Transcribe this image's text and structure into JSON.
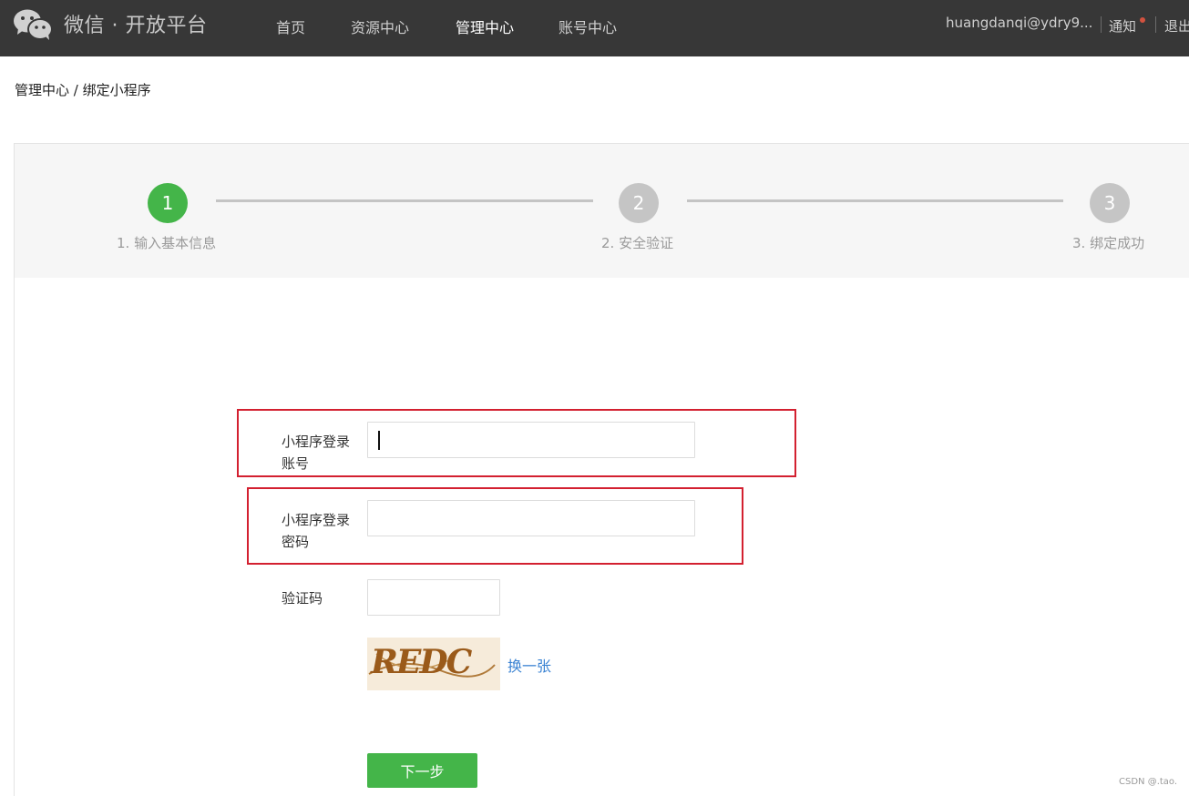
{
  "topbar": {
    "brand": "微信 · 开放平台",
    "nav": [
      {
        "label": "首页",
        "active": false
      },
      {
        "label": "资源中心",
        "active": false
      },
      {
        "label": "管理中心",
        "active": true
      },
      {
        "label": "账号中心",
        "active": false
      }
    ],
    "user": "huangdanqi@ydry9...",
    "notify": "通知",
    "logout": "退出"
  },
  "breadcrumb": "管理中心 / 绑定小程序",
  "steps": [
    {
      "number": "1",
      "label": "1. 输入基本信息",
      "state": "active"
    },
    {
      "number": "2",
      "label": "2. 安全验证",
      "state": "pending"
    },
    {
      "number": "3",
      "label": "3. 绑定成功",
      "state": "pending"
    }
  ],
  "form": {
    "account_label": "小程序登录账号",
    "account_value": "",
    "password_label": "小程序登录密码",
    "password_value": "",
    "captcha_label": "验证码",
    "captcha_value": "",
    "captcha_image_text": "REDC",
    "refresh_label": "换一张",
    "next_label": "下一步"
  },
  "watermark": "CSDN @.tao.",
  "colors": {
    "topbar": "#373737",
    "accent_green": "#44b549",
    "highlight_red": "#d32030",
    "link_blue": "#3c84d3"
  },
  "icons": {
    "logo": "wechat-logo-icon",
    "notify_dot": "notification-dot-icon"
  }
}
